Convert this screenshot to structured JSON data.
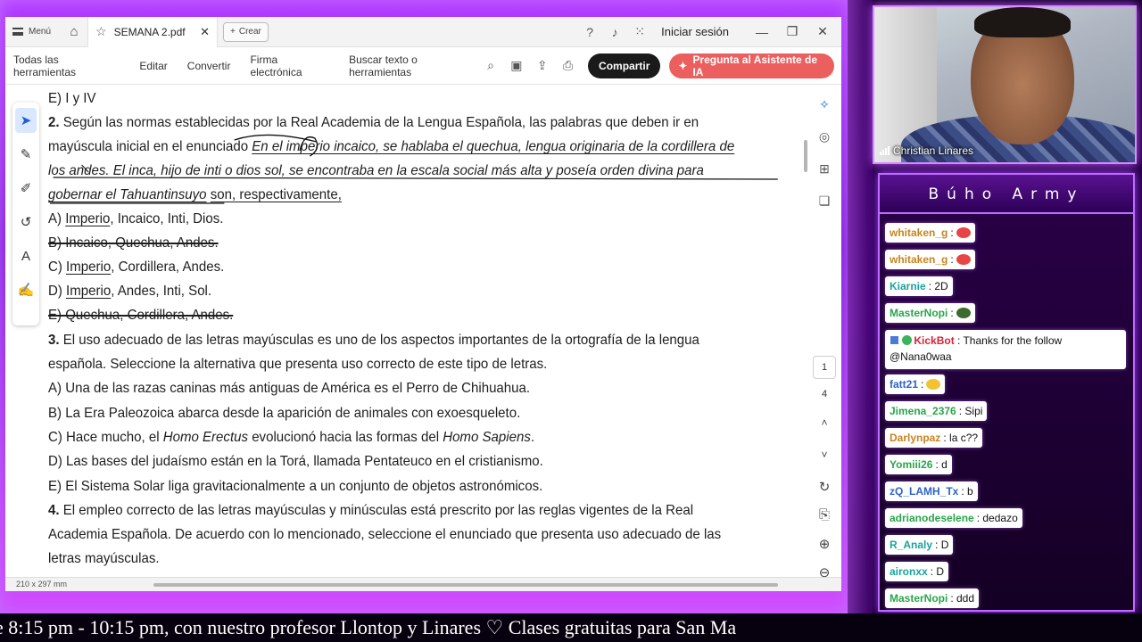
{
  "window": {
    "menu_label": "Menú",
    "tab_title": "SEMANA 2.pdf",
    "new_label": "Crear",
    "signin": "Iniciar sesión"
  },
  "toolbar": {
    "all_tools": "Todas las herramientas",
    "edit": "Editar",
    "convert": "Convertir",
    "esign": "Firma electrónica",
    "search": "Buscar texto o herramientas",
    "share": "Compartir",
    "ai": "Pregunta al Asistente de IA"
  },
  "document": {
    "l01": "E) I y IV",
    "l02_num": "2.",
    "l02": "Según las normas establecidas por la Real Academia de la Lengua Española, las palabras que deben ir en",
    "l03a": "mayúscula inicial en el enunciado",
    "l03b": "En el imperio incaico, se hablaba el quechua, lengua originaria de la cordillera de",
    "l04": "los andes. El inca, hijo de inti o dios sol, se encontraba en la escala social más alta y poseía orden divina para",
    "l05a": "gobernar el Tahuantinsuyo",
    "l05b": "son, respectivamente,",
    "l06a": "A) ",
    "l06b": "Imperio",
    "l06c": ", Incaico, Inti, Dios.",
    "l07": "B) Incaico, Quechua, Andes.",
    "l08a": "C) ",
    "l08b": "Imperio",
    "l08c": ", Cordillera, Andes.",
    "l09a": "D) ",
    "l09b": "Imperio",
    "l09c": ", Andes, Inti, Sol.",
    "l10": "E) Quechua, Cordillera, Andes.",
    "l11_num": "3.",
    "l11": "El uso adecuado de las letras mayúsculas es uno de los aspectos importantes de la ortografía de la lengua",
    "l12": "española. Seleccione la alternativa que presenta uso correcto de este tipo de letras.",
    "l13": "A) Una de las razas caninas más antiguas de América es el Perro de Chihuahua.",
    "l14": "B) La Era Paleozoica abarca desde la aparición de animales con exoesqueleto.",
    "l15a": "C) Hace mucho, el ",
    "l15b": "Homo Erectus",
    "l15c": " evolucionó hacia las formas del ",
    "l15d": "Homo Sapiens",
    "l15e": ".",
    "l16": "D) Las bases del judaísmo están en la Torá, llamada Pentateuco en el cristianismo.",
    "l17": "E) El Sistema Solar liga gravitacionalmente a un conjunto de objetos astronómicos.",
    "l18_num": "4.",
    "l18": "El empleo correcto de las letras mayúsculas y minúsculas está prescrito por las reglas vigentes de la Real",
    "l19": "Academia Española. De acuerdo con lo mencionado, seleccione el enunciado que presenta uso adecuado de las",
    "l20": "letras mayúsculas."
  },
  "status": {
    "page_size": "210 x 297 mm"
  },
  "pager": {
    "current": "1",
    "total": "4"
  },
  "webcam": {
    "name": "Christian Linares"
  },
  "chat": {
    "title": "Búho Army",
    "messages": [
      {
        "user": "whitaken_g",
        "text": ":",
        "emote": "#e84545"
      },
      {
        "user": "whitaken_g",
        "text": ":",
        "emote": "#e84545"
      },
      {
        "user": "Kiarnie",
        "text": ": 2D"
      },
      {
        "user": "MasterNopi",
        "text": ":",
        "emote": "#3d6b2e"
      },
      {
        "user": "KickBot",
        "text": ": Thanks for the follow @Nana0waa"
      },
      {
        "user": "fatt21",
        "text": ":",
        "emote": "#f2c230"
      },
      {
        "user": "Jimena_2376",
        "text": ": Sipi"
      },
      {
        "user": "Darlynpaz",
        "text": ": la c??"
      },
      {
        "user": "Yomiii26",
        "text": ": d"
      },
      {
        "user": "zQ_LAMH_Tx",
        "text": ": b"
      },
      {
        "user": "adrianodeselene",
        "text": ": dedazo"
      },
      {
        "user": "R_Analy",
        "text": ": D"
      },
      {
        "user": "aironxx",
        "text": ": D"
      },
      {
        "user": "MasterNopi",
        "text": ": ddd"
      }
    ],
    "colors": {
      "whitaken_g": "#c8841e",
      "Kiarnie": "#1aa39a",
      "MasterNopi": "#2aa54c",
      "KickBot": "#d6243a",
      "fatt21": "#2d63c9",
      "Jimena_2376": "#2aa54c",
      "Darlynpaz": "#c8841e",
      "Yomiii26": "#2aa54c",
      "zQ_LAMH_Tx": "#2d63c9",
      "adrianodeselene": "#2aa54c",
      "R_Analy": "#1aa39a",
      "aironxx": "#1aa39a"
    }
  },
  "ticker": {
    "text": "e 8:15 pm - 10:15 pm, con nuestro profesor Llontop y Linares ♡     Clases gratuitas para San Ma"
  }
}
